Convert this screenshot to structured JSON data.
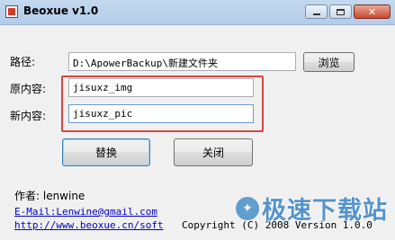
{
  "window": {
    "title": "Beoxue v1.0",
    "minimize_icon": "minimize-icon",
    "maximize_icon": "maximize-icon",
    "close_glyph": "✕"
  },
  "form": {
    "path_label": "路径:",
    "path_value": "D:\\ApowerBackup\\新建文件夹",
    "browse_label": "浏览",
    "original_label": "原内容:",
    "original_value": "jisuxz_img",
    "new_label": "新内容:",
    "new_value": "jisuxz_pic",
    "replace_label": "替换",
    "close_label": "关闭"
  },
  "footer": {
    "author": "作者: lenwine",
    "email": "E-Mail:Lenwine@gmail.com",
    "website": "http://www.beoxue.cn/soft",
    "copyright": "Copyright (C) 2008 Version 1.0.0"
  },
  "watermark": {
    "text": "极速下载站",
    "logo_glyph": "✦"
  },
  "colors": {
    "highlight_border": "#d64541",
    "link": "#0000cc",
    "titlebar": "#c4d9ef"
  }
}
